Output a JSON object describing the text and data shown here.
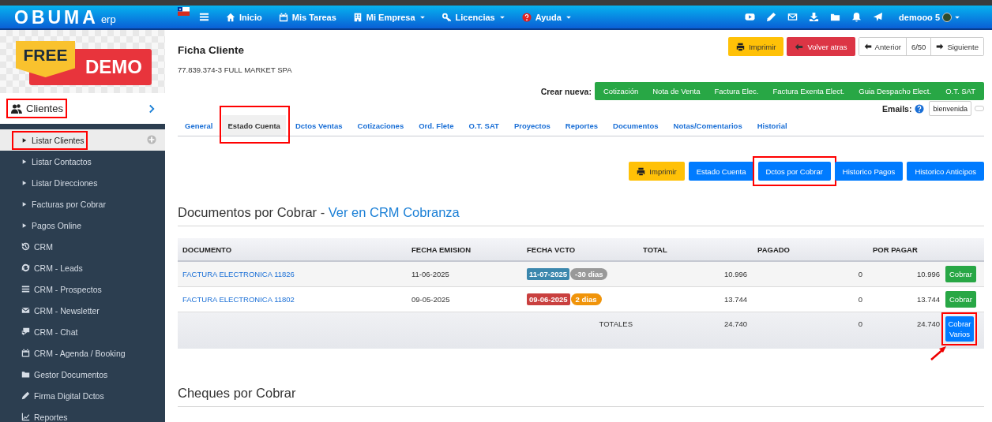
{
  "topbar": {
    "logo": "OBUMA",
    "logo_suffix": "erp",
    "nav": [
      {
        "label": "Inicio",
        "kind": "home",
        "dropdown": false
      },
      {
        "label": "Mis Tareas",
        "kind": "calendar",
        "dropdown": false
      },
      {
        "label": "Mi Empresa",
        "kind": "building",
        "dropdown": true
      },
      {
        "label": "Licencias",
        "kind": "key",
        "dropdown": true
      },
      {
        "label": "Ayuda",
        "kind": "help",
        "dropdown": true
      }
    ],
    "user": "demooo 5"
  },
  "sidebar": {
    "banner": [
      "FREE",
      "DEMO"
    ],
    "section": {
      "label": "Clientes",
      "highlighted": true
    },
    "items": [
      {
        "label": "Listar Clientes",
        "kind": "sub",
        "selected": true,
        "highlighted": true
      },
      {
        "label": "Listar Contactos",
        "kind": "sub",
        "selected": false,
        "highlighted": false
      },
      {
        "label": "Listar Direcciones",
        "kind": "sub",
        "selected": false,
        "highlighted": false
      },
      {
        "label": "Facturas por Cobrar",
        "kind": "sub",
        "selected": false,
        "highlighted": false
      },
      {
        "label": "Pagos Online",
        "kind": "sub",
        "selected": false,
        "highlighted": false
      },
      {
        "label": "CRM",
        "kind": "history",
        "selected": false,
        "highlighted": false
      },
      {
        "label": "CRM - Leads",
        "kind": "sync",
        "selected": false,
        "highlighted": false
      },
      {
        "label": "CRM - Prospectos",
        "kind": "list",
        "selected": false,
        "highlighted": false
      },
      {
        "label": "CRM - Newsletter",
        "kind": "mail",
        "selected": false,
        "highlighted": false
      },
      {
        "label": "CRM - Chat",
        "kind": "chat",
        "selected": false,
        "highlighted": false
      },
      {
        "label": "CRM - Agenda / Booking",
        "kind": "calendar",
        "selected": false,
        "highlighted": false
      },
      {
        "label": "Gestor Documentos",
        "kind": "folder",
        "selected": false,
        "highlighted": false
      },
      {
        "label": "Firma Digital Dctos",
        "kind": "pen",
        "selected": false,
        "highlighted": false
      },
      {
        "label": "Reportes",
        "kind": "chart",
        "selected": false,
        "highlighted": false
      }
    ]
  },
  "page": {
    "title": "Ficha Cliente",
    "subtitle": "77.839.374-3 FULL MARKET SPA",
    "actions": [
      {
        "label": "Imprimir",
        "kind": "print"
      },
      {
        "label": "Volver atras",
        "kind": "back"
      }
    ],
    "pager": {
      "prev": "Anterior",
      "position": "6/50",
      "next": "Siguiente"
    },
    "create": {
      "label": "Crear nueva:",
      "items": [
        "Cotización",
        "Nota de Venta",
        "Factura Elec.",
        "Factura Exenta Elect.",
        "Guia Despacho Elect.",
        "O.T. SAT"
      ]
    },
    "emails": {
      "label": "Emails:",
      "value": "bienvenida"
    },
    "tabs": [
      {
        "label": "General",
        "selected": false,
        "highlighted": false
      },
      {
        "label": "Estado Cuenta",
        "selected": true,
        "highlighted": true
      },
      {
        "label": "Dctos Ventas",
        "selected": false,
        "highlighted": false
      },
      {
        "label": "Cotizaciones",
        "selected": false,
        "highlighted": false
      },
      {
        "label": "Ord. Flete",
        "selected": false,
        "highlighted": false
      },
      {
        "label": "O.T. SAT",
        "selected": false,
        "highlighted": false
      },
      {
        "label": "Proyectos",
        "selected": false,
        "highlighted": false
      },
      {
        "label": "Reportes",
        "selected": false,
        "highlighted": false
      },
      {
        "label": "Documentos",
        "selected": false,
        "highlighted": false
      },
      {
        "label": "Notas/Comentarios",
        "selected": false,
        "highlighted": false
      },
      {
        "label": "Historial",
        "selected": false,
        "highlighted": false
      }
    ],
    "report_buttons": [
      {
        "label": "Imprimir",
        "kind": "print",
        "highlighted": false
      },
      {
        "label": "Estado Cuenta",
        "kind": "report",
        "highlighted": false
      },
      {
        "label": "Dctos por Cobrar",
        "kind": "report",
        "highlighted": true
      },
      {
        "label": "Historico Pagos",
        "kind": "report",
        "highlighted": false
      },
      {
        "label": "Historico Anticipos",
        "kind": "report",
        "highlighted": false
      }
    ],
    "section": {
      "title": "Documentos por Cobrar - ",
      "link": "Ver en CRM Cobranza"
    },
    "table": {
      "columns": [
        "DOCUMENTO",
        "FECHA EMISION",
        "FECHA VCTO",
        "TOTAL",
        "PAGADO",
        "POR PAGAR"
      ],
      "rows": [
        {
          "document": "FACTURA ELECTRONICA 11826",
          "issued": "11-06-2025",
          "due": {
            "text": "11-07-2025",
            "color": "#3b87ad"
          },
          "days": {
            "text": "-30 dias",
            "color": "#999999"
          },
          "total": "10.996",
          "paid": "0",
          "pending": "10.996",
          "action": "Cobrar"
        },
        {
          "document": "FACTURA ELECTRONICA 11802",
          "issued": "09-05-2025",
          "due": {
            "text": "09-06-2025",
            "color": "#c9403f"
          },
          "days": {
            "text": "2 dias",
            "color": "#f0940a"
          },
          "total": "13.744",
          "paid": "0",
          "pending": "13.744",
          "action": "Cobrar"
        }
      ],
      "totals": {
        "label": "TOTALES",
        "total": "24.740",
        "paid": "0",
        "pending": "24.740",
        "action": "Cobrar Varios",
        "highlighted": true,
        "arrow": true
      }
    },
    "section2": "Cheques por Cobrar"
  }
}
